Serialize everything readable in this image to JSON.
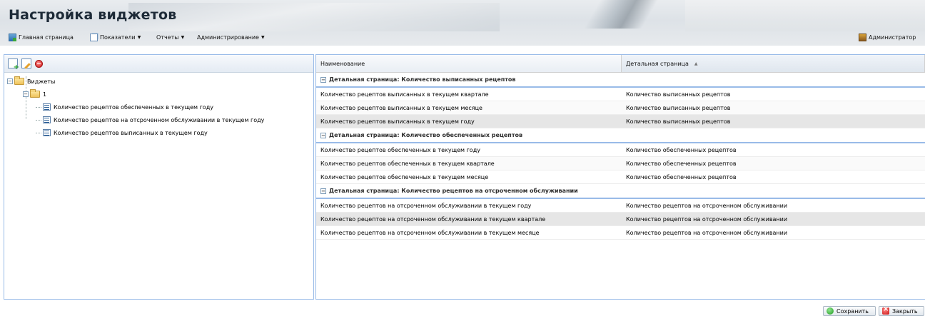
{
  "app": {
    "title": "Настройка виджетов"
  },
  "menu": {
    "home": "Главная страница",
    "indicators": "Показатели",
    "reports": "Отчеты",
    "administration": "Администрирование",
    "user": "Администратор"
  },
  "tree": {
    "root": "Виджеты",
    "node": "1",
    "items": [
      "Количество рецептов обеспеченных в текущем году",
      "Количество рецептов на отсроченном обслуживании в текущем году",
      "Количество рецептов выписанных в текущем году"
    ]
  },
  "grid": {
    "columns": [
      "Наименование",
      "Детальная страница"
    ],
    "groups": [
      {
        "title": "Детальная страница: Количество выписанных рецептов",
        "rows": [
          [
            "Количество рецептов выписанных в текущем квартале",
            "Количество выписанных рецептов"
          ],
          [
            "Количество рецептов выписанных в текущем месяце",
            "Количество выписанных рецептов"
          ],
          [
            "Количество рецептов выписанных в текущем году",
            "Количество выписанных рецептов"
          ]
        ]
      },
      {
        "title": "Детальная страница: Количество обеспеченных рецептов",
        "rows": [
          [
            "Количество рецептов обеспеченных в текущем году",
            "Количество обеспеченных рецептов"
          ],
          [
            "Количество рецептов обеспеченных в текущем квартале",
            "Количество обеспеченных рецептов"
          ],
          [
            "Количество рецептов обеспеченных в текущем месяце",
            "Количество обеспеченных рецептов"
          ]
        ]
      },
      {
        "title": "Детальная страница: Количество рецептов на отсроченном обслуживании",
        "rows": [
          [
            "Количество рецептов на отсроченном обслуживании в текущем году",
            "Количество рецептов на отсроченном обслуживании"
          ],
          [
            "Количество рецептов на отсроченном обслуживании в текущем квартале",
            "Количество рецептов на отсроченном обслуживании"
          ],
          [
            "Количество рецептов на отсроченном обслуживании в текущем месяце",
            "Количество рецептов на отсроченном обслуживании"
          ]
        ]
      }
    ]
  },
  "buttons": {
    "save": "Сохранить",
    "close": "Закрыть"
  }
}
